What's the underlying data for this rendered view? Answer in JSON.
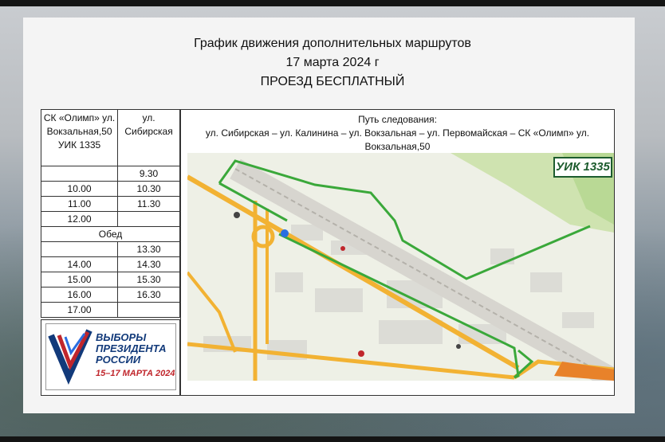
{
  "header": {
    "line1": "График движения дополнительных маршрутов",
    "line2": "17 марта 2024 г",
    "line3": "ПРОЕЗД БЕСПЛАТНЫЙ"
  },
  "schedule": {
    "col1_header": "СК «Олимп» ул. Вокзальная,50 УИК 1335",
    "col2_header": "ул. Сибирская",
    "rows": [
      [
        "",
        "9.30"
      ],
      [
        "10.00",
        "10.30"
      ],
      [
        "11.00",
        "11.30"
      ],
      [
        "12.00",
        ""
      ],
      [
        "Обед"
      ],
      [
        "",
        "13.30"
      ],
      [
        "14.00",
        "14.30"
      ],
      [
        "15.00",
        "15.30"
      ],
      [
        "16.00",
        "16.30"
      ],
      [
        "17.00",
        ""
      ]
    ]
  },
  "route": {
    "label": "Путь следования:",
    "path": "ул. Сибирская – ул. Калинина – ул. Вокзальная – ул. Первомайская – СК «Олимп» ул. Вокзальная,50"
  },
  "map": {
    "badge": "УИК 1335",
    "route_color": "#3aa83a",
    "road_color": "#f2b233"
  },
  "logo": {
    "line1": "ВЫБОРЫ",
    "line2": "ПРЕЗИДЕНТА",
    "line3": "РОССИИ",
    "date": "15–17 МАРТА 2024",
    "icon": "ballot-check-icon"
  }
}
